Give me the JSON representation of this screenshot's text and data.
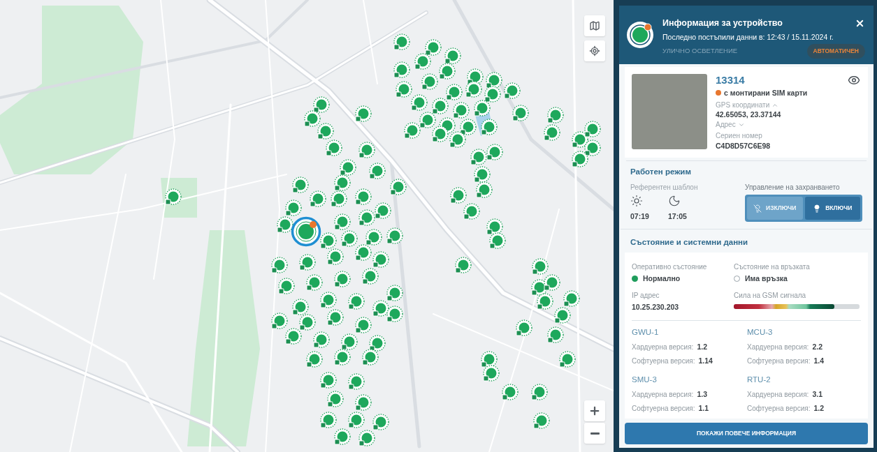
{
  "panel": {
    "header": {
      "title": "Информация за устройство",
      "subtitle": "Последно постъпили данни в: 12:43 / 15.11.2024 г.",
      "category": "УЛИЧНО ОСВЕТЛЕНИЕ",
      "mode_badge": "АВТОМАТИЧЕН"
    },
    "device": {
      "id": "13314",
      "status": "с монтирани SIM карти",
      "gps": {
        "label": "GPS координати",
        "expanded": true,
        "value": "42.65053, 23.37144"
      },
      "address": {
        "label": "Адрес",
        "expanded": false
      },
      "serial": {
        "label": "Сериен номер",
        "value": "C4D8D57C6E98"
      }
    },
    "work_mode": {
      "title": "Работен режим",
      "schedule": {
        "label": "Референтен шаблон",
        "times": [
          {
            "kind": "day",
            "time": "07:19"
          },
          {
            "kind": "night",
            "time": "17:05"
          }
        ]
      },
      "power": {
        "label": "Управление на захранването",
        "options": [
          {
            "kind": "off",
            "label": "ИЗКЛЮЧИ",
            "selected": false
          },
          {
            "kind": "on",
            "label": "ВКЛЮЧИ",
            "selected": true
          }
        ]
      }
    },
    "status": {
      "title": "Състояние и системни данни",
      "items": [
        {
          "kind": "dot",
          "label": "Оперативно състояние",
          "value": "Нормално"
        },
        {
          "kind": "ring",
          "label": "Състояние на връзката",
          "value": "Има връзка"
        },
        {
          "kind": "text",
          "label": "IP адрес",
          "value": "10.25.230.203"
        },
        {
          "kind": "meter",
          "label": "Сила на GSM сигнала",
          "level": 0.8
        }
      ]
    },
    "modules": [
      {
        "name": "GWU-1",
        "rows": [
          {
            "label": "Хардуерна версия:",
            "value": "1.2"
          },
          {
            "label": "Софтуерна версия:",
            "value": "1.14"
          }
        ]
      },
      {
        "name": "MCU-3",
        "rows": [
          {
            "label": "Хардуерна версия:",
            "value": "2.2"
          },
          {
            "label": "Софтуерна версия:",
            "value": "1.4"
          }
        ]
      },
      {
        "name": "SMU-3",
        "rows": [
          {
            "label": "Хардуерна версия:",
            "value": "1.3"
          },
          {
            "label": "Софтуерна версия:",
            "value": "1.1"
          }
        ]
      },
      {
        "name": "RTU-2",
        "rows": [
          {
            "label": "Хардуерна версия:",
            "value": "3.1"
          },
          {
            "label": "Софтуерна версия:",
            "value": "1.2"
          }
        ]
      }
    ],
    "more_button": "ПОКАЖИ ПОВЕЧЕ ИНФОРМАЦИЯ"
  }
}
